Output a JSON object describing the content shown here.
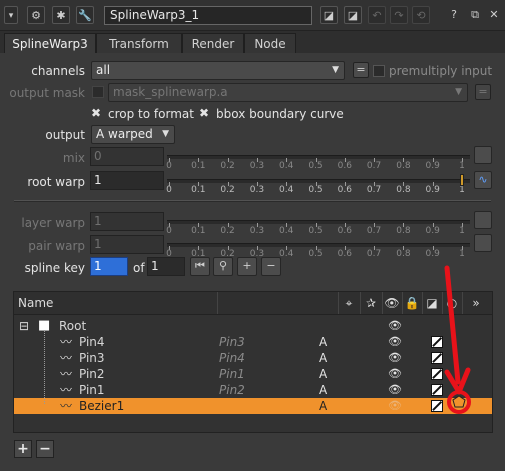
{
  "title_bar": {
    "node_name": "SplineWarp3_1",
    "icons": [
      "gear-icon",
      "bug-icon",
      "wrench-icon",
      "question-icon",
      "float-icon",
      "close-icon"
    ]
  },
  "tabs": [
    {
      "label": "SplineWarp3",
      "active": true
    },
    {
      "label": "Transform",
      "active": false
    },
    {
      "label": "Render",
      "active": false
    },
    {
      "label": "Node",
      "active": false
    }
  ],
  "params": {
    "channels_label": "channels",
    "channels_value": "all",
    "premultiply_label": "premultiply input",
    "output_mask_label": "output mask",
    "output_mask_value": "mask_splinewarp.a",
    "crop_label": "crop to format",
    "bbox_label": "bbox boundary curve",
    "output_label": "output",
    "output_value": "A warped",
    "mix_label": "mix",
    "mix_value": "0",
    "root_warp_label": "root warp",
    "root_warp_value": "1",
    "layer_warp_label": "layer warp",
    "layer_warp_value": "1",
    "pair_warp_label": "pair warp",
    "pair_warp_value": "1",
    "spline_key_label": "spline key",
    "spline_key_value": "1",
    "of_label": "of",
    "of_value": "1",
    "slider_ticks": [
      "0",
      "0.1",
      "0.2",
      "0.3",
      "0.4",
      "0.5",
      "0.6",
      "0.7",
      "0.8",
      "0.9",
      "1"
    ],
    "root_warp_level": 1.0
  },
  "curves": {
    "header": {
      "name": "Name"
    },
    "rows": [
      {
        "name": "Root",
        "link": "",
        "blend": "",
        "indent": 0,
        "selected": false
      },
      {
        "name": "Pin4",
        "link": "Pin3",
        "blend": "A",
        "indent": 1,
        "selected": false
      },
      {
        "name": "Pin3",
        "link": "Pin4",
        "blend": "A",
        "indent": 1,
        "selected": false
      },
      {
        "name": "Pin2",
        "link": "Pin1",
        "blend": "A",
        "indent": 1,
        "selected": false
      },
      {
        "name": "Pin1",
        "link": "Pin2",
        "blend": "A",
        "indent": 1,
        "selected": false
      },
      {
        "name": "Bezier1",
        "link": "",
        "blend": "A",
        "indent": 1,
        "selected": true
      }
    ]
  },
  "annotation": {
    "arrow_color": "#e8121a",
    "highlight_color": "#f0922c"
  },
  "footer": {
    "add": "+",
    "remove": "−"
  }
}
